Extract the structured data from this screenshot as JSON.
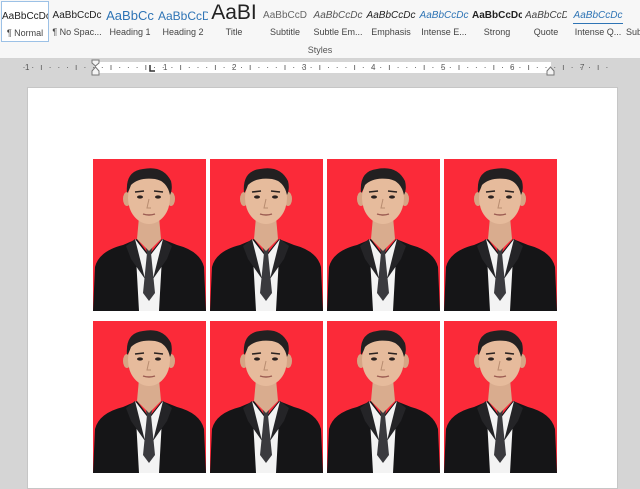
{
  "styles_gallery": {
    "group_label": "Styles",
    "items": [
      {
        "preview": "AaBbCcDc",
        "label": "¶ Normal",
        "selected": true
      },
      {
        "preview": "AaBbCcDc",
        "label": "¶ No Spac..."
      },
      {
        "preview": "AaBbCc",
        "label": "Heading 1"
      },
      {
        "preview": "AaBbCcD",
        "label": "Heading 2"
      },
      {
        "preview": "AaBI",
        "label": "Title"
      },
      {
        "preview": "AaBbCcD",
        "label": "Subtitle"
      },
      {
        "preview": "AaBbCcDc",
        "label": "Subtle Em..."
      },
      {
        "preview": "AaBbCcDc",
        "label": "Emphasis"
      },
      {
        "preview": "AaBbCcDc",
        "label": "Intense E..."
      },
      {
        "preview": "AaBbCcDc",
        "label": "Strong"
      },
      {
        "preview": "AaBbCcDc",
        "label": "Quote"
      },
      {
        "preview": "AaBbCcDc",
        "label": "Intense Q..."
      },
      {
        "preview": "",
        "label": "Sub"
      }
    ]
  },
  "ruler": {
    "numbers": [
      "1",
      "1",
      "2",
      "3",
      "4",
      "5",
      "6",
      "7"
    ]
  },
  "document": {
    "photo_background": "#fb2a39",
    "photo_rows": 2,
    "photos_per_row": 4,
    "photo_subject": "passport-photo-man-in-black-suit"
  },
  "colors": {
    "accent": "#9cc1e6",
    "heading_blue": "#2e74b5",
    "photo_red": "#fb2a39"
  }
}
